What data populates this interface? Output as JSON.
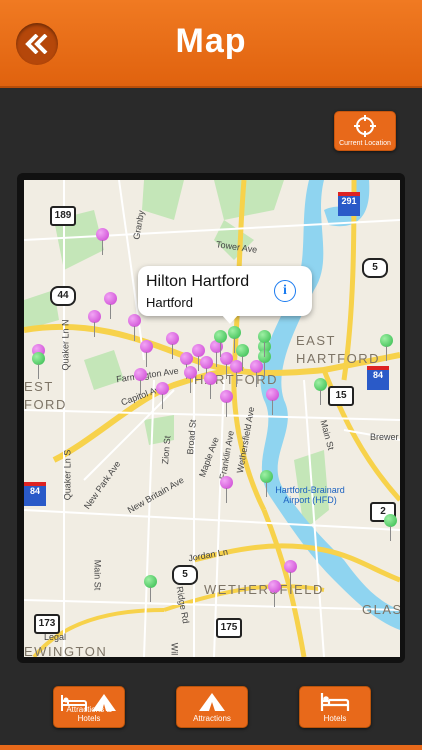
{
  "header": {
    "title": "Map",
    "back_icon": "double-chevron-left-icon"
  },
  "current_location": {
    "label": "Current Location",
    "icon": "crosshair-icon"
  },
  "map": {
    "callout": {
      "title": "Hilton Hartford",
      "subtitle": "Hartford"
    },
    "area_labels": {
      "east_hartford": "EAST\nHARTFORD",
      "west_hartford": "EST\nFORD",
      "hartford": "HARTFORD",
      "wethersfield": "WETHERSFIELD",
      "newington": "EWINGTON",
      "glas": "GLAS"
    },
    "roads": [
      "Granby",
      "Tower Ave",
      "Quaker Ln N",
      "Farmington Ave",
      "Capitol Ave",
      "New Park Ave",
      "Zion St",
      "Broad St",
      "Maple Ave",
      "Franklin Ave",
      "Wethersfield Ave",
      "New Britain Ave",
      "Jordan Ln",
      "Main St",
      "Ridge Rd",
      "Brewer",
      "Hartford-Brainard Airport (HFD)",
      "Legal",
      "Main St",
      "Quaker Ln S",
      "Wil"
    ],
    "shields": [
      "189",
      "44",
      "5",
      "291",
      "84",
      "15",
      "2",
      "5",
      "173",
      "175",
      "84"
    ],
    "colors": {
      "water": "#8fd4f0",
      "park": "#c4e6b8",
      "highway": "#f7d24b",
      "land": "#f1ede3"
    }
  },
  "tabs": [
    {
      "label": "Attractions & Hotels",
      "icon": "bed-tent-icon"
    },
    {
      "label": "Attractions",
      "icon": "tent-icon"
    },
    {
      "label": "Hotels",
      "icon": "bed-icon"
    }
  ]
}
